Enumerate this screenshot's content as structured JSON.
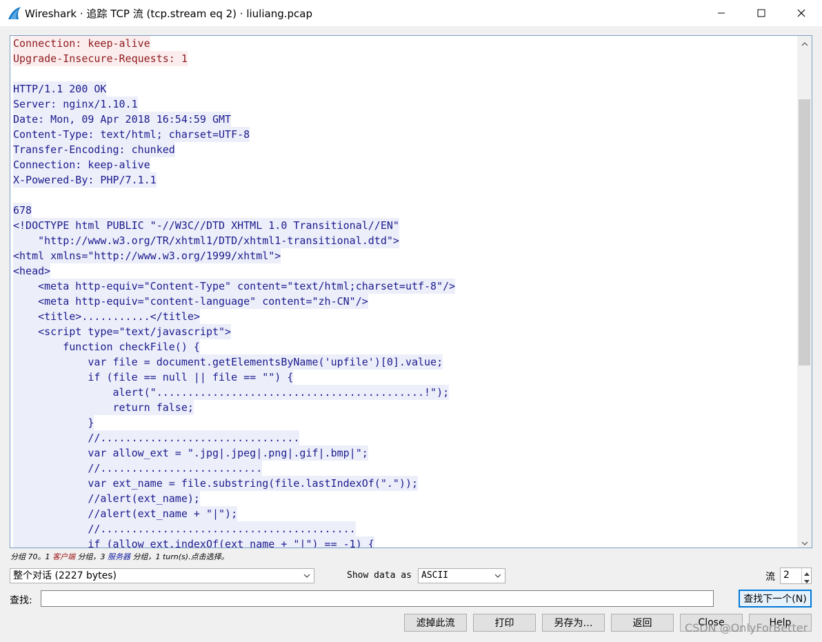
{
  "window": {
    "title": "Wireshark · 追踪 TCP 流 (tcp.stream eq 2) · liuliang.pcap",
    "icon": "wireshark-fin-icon"
  },
  "stream": {
    "lines": [
      {
        "text": "Connection: keep-alive",
        "side": "client"
      },
      {
        "text": "Upgrade-Insecure-Requests: 1",
        "side": "client"
      },
      {
        "text": "",
        "side": "blank"
      },
      {
        "text": "HTTP/1.1 200 OK",
        "side": "server"
      },
      {
        "text": "Server: nginx/1.10.1",
        "side": "server"
      },
      {
        "text": "Date: Mon, 09 Apr 2018 16:54:59 GMT",
        "side": "server"
      },
      {
        "text": "Content-Type: text/html; charset=UTF-8",
        "side": "server"
      },
      {
        "text": "Transfer-Encoding: chunked",
        "side": "server"
      },
      {
        "text": "Connection: keep-alive",
        "side": "server"
      },
      {
        "text": "X-Powered-By: PHP/7.1.1",
        "side": "server"
      },
      {
        "text": "",
        "side": "blank"
      },
      {
        "text": "678",
        "side": "server"
      },
      {
        "text": "<!DOCTYPE html PUBLIC \"-//W3C//DTD XHTML 1.0 Transitional//EN\"",
        "side": "server"
      },
      {
        "text": "    \"http://www.w3.org/TR/xhtml1/DTD/xhtml1-transitional.dtd\">",
        "side": "server"
      },
      {
        "text": "<html xmlns=\"http://www.w3.org/1999/xhtml\">",
        "side": "server"
      },
      {
        "text": "<head>",
        "side": "server"
      },
      {
        "text": "    <meta http-equiv=\"Content-Type\" content=\"text/html;charset=utf-8\"/>",
        "side": "server"
      },
      {
        "text": "    <meta http-equiv=\"content-language\" content=\"zh-CN\"/>",
        "side": "server"
      },
      {
        "text": "    <title>...........</title>",
        "side": "server"
      },
      {
        "text": "    <script type=\"text/javascript\">",
        "side": "server"
      },
      {
        "text": "        function checkFile() {",
        "side": "server"
      },
      {
        "text": "            var file = document.getElementsByName('upfile')[0].value;",
        "side": "server"
      },
      {
        "text": "            if (file == null || file == \"\") {",
        "side": "server"
      },
      {
        "text": "                alert(\"...........................................!\");",
        "side": "server"
      },
      {
        "text": "                return false;",
        "side": "server"
      },
      {
        "text": "            }",
        "side": "server"
      },
      {
        "text": "            //................................",
        "side": "server"
      },
      {
        "text": "            var allow_ext = \".jpg|.jpeg|.png|.gif|.bmp|\";",
        "side": "server"
      },
      {
        "text": "            //..........................",
        "side": "server"
      },
      {
        "text": "            var ext_name = file.substring(file.lastIndexOf(\".\"));",
        "side": "server"
      },
      {
        "text": "            //alert(ext_name);",
        "side": "server"
      },
      {
        "text": "            //alert(ext_name + \"|\");",
        "side": "server"
      },
      {
        "text": "            //.........................................",
        "side": "server"
      },
      {
        "text": "            if (allow_ext.indexOf(ext_name + \"|\") == -1) {",
        "side": "server"
      }
    ]
  },
  "status": {
    "prefix": "分组 70。1 ",
    "client_label": "客户端",
    "middle": " 分组，3 ",
    "server_label": "服务器",
    "suffix": " 分组，1 turn(s).点击选择。"
  },
  "controls": {
    "conversation_select": "整个对话 (2227 bytes)",
    "show_data_label": "Show data as",
    "show_data_value": "ASCII",
    "stream_label": "流",
    "stream_value": "2",
    "find_label": "查找:",
    "find_value": "",
    "find_next_button": "查找下一个(N)"
  },
  "buttons": {
    "filter_out": "滤掉此流",
    "print": "打印",
    "save_as": "另存为…",
    "back": "返回",
    "close": "Close",
    "help": "Help"
  },
  "watermark": "CSDN @OnlyForBetter",
  "colors": {
    "client_text": "#8e1a1e",
    "client_bg": "#fbeded",
    "server_text": "#1b1b8c",
    "server_bg": "#eceefa",
    "accent": "#0078d7"
  }
}
